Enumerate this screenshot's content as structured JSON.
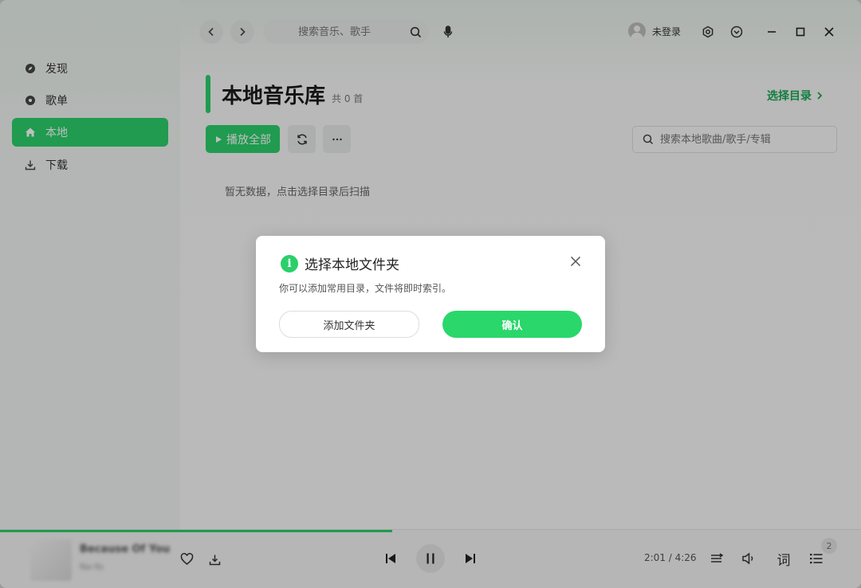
{
  "sidebar": {
    "items": [
      {
        "label": "发现",
        "icon": "compass-icon"
      },
      {
        "label": "歌单",
        "icon": "disc-icon"
      },
      {
        "label": "本地",
        "icon": "home-icon",
        "active": true
      },
      {
        "label": "下载",
        "icon": "download-icon"
      }
    ]
  },
  "topbar": {
    "search_placeholder": "搜索音乐、歌手",
    "login_label": "未登录"
  },
  "page": {
    "title": "本地音乐库",
    "count": "共 0 首",
    "choose_dir": "选择目录",
    "play_all": "播放全部",
    "local_search_placeholder": "搜索本地歌曲/歌手/专辑",
    "empty_text": "暂无数据，点击选择目录后扫描"
  },
  "player": {
    "song_title": "Because Of You",
    "song_artist": "Ne-Yo",
    "time": "2:01 / 4:26",
    "progress": 0.456,
    "queue_count": "2",
    "lyrics_label": "词"
  },
  "modal": {
    "title": "选择本地文件夹",
    "desc": "你可以添加常用目录，文件将即时索引。",
    "add_folder": "添加文件夹",
    "confirm": "确认"
  },
  "colors": {
    "accent": "#2bcf6a",
    "link": "#1aa755"
  }
}
